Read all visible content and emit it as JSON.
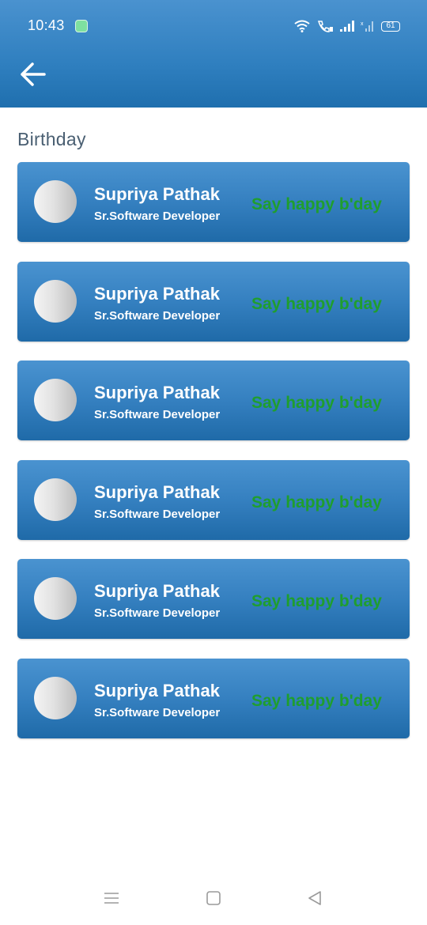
{
  "status_bar": {
    "time": "10:43",
    "battery": "61"
  },
  "header": {
    "back_icon": "arrow-left-icon"
  },
  "section": {
    "title": "Birthday"
  },
  "birthdays": [
    {
      "name": "Supriya Pathak",
      "role": "Sr.Software Developer",
      "action": "Say happy b'day"
    },
    {
      "name": "Supriya Pathak",
      "role": "Sr.Software Developer",
      "action": "Say happy b'day"
    },
    {
      "name": "Supriya Pathak",
      "role": "Sr.Software Developer",
      "action": "Say happy b'day"
    },
    {
      "name": "Supriya Pathak",
      "role": "Sr.Software Developer",
      "action": "Say happy b'day"
    },
    {
      "name": "Supriya Pathak",
      "role": "Sr.Software Developer",
      "action": "Say happy b'day"
    },
    {
      "name": "Supriya Pathak",
      "role": "Sr.Software Developer",
      "action": "Say happy b'day"
    }
  ],
  "colors": {
    "primary": "#2f7fbf",
    "wish_text": "#1f9e2e",
    "section_title": "#4a5f72"
  }
}
